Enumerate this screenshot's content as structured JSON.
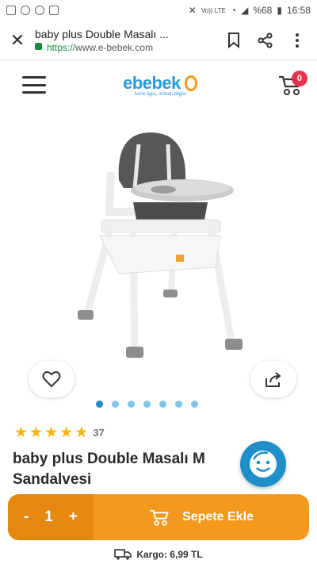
{
  "status_bar": {
    "network": "Vo)) LTE",
    "battery": "%68",
    "time": "16:58"
  },
  "browser": {
    "page_title": "baby plus Double Masalı ...",
    "url_scheme": "https://",
    "url_host": "www.e-bebek.com"
  },
  "header": {
    "logo_text": "ebebek",
    "logo_tagline": "Anne ilgisi, uzman bilgisi",
    "cart_count": "0"
  },
  "gallery": {
    "slide_count": 7,
    "active_slide": 1
  },
  "rating": {
    "stars": 5,
    "count": "37"
  },
  "product": {
    "title_line1": "baby plus Double Masalı M",
    "title_line2": "Sandalvesi"
  },
  "cart_bar": {
    "minus": "-",
    "quantity": "1",
    "plus": "+",
    "add_label": "Sepete Ekle"
  },
  "shipping": {
    "label": "Kargo: 6,99 TL"
  },
  "colors": {
    "brand_blue": "#2a9bd8",
    "accent_orange": "#f39a1e",
    "badge_red": "#e5334a",
    "star_gold": "#f5b50a"
  }
}
